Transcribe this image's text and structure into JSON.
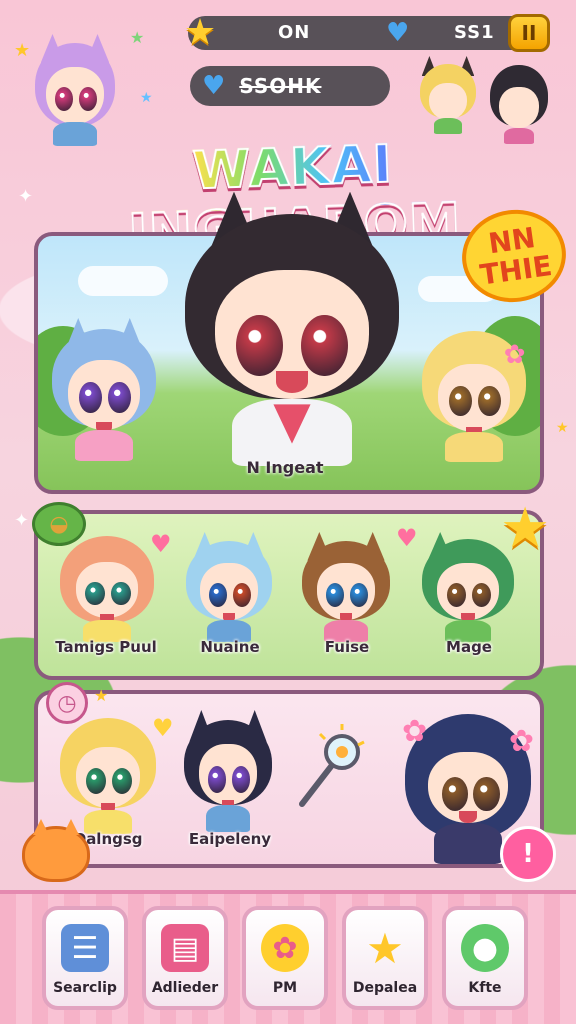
{
  "status_bar": {
    "mode_label": "ON",
    "score": "SS1",
    "pause_label": "II"
  },
  "search": {
    "text": "SSOHK"
  },
  "title": "WAKAI INGHAROM",
  "badge": {
    "line1": "NN",
    "line2": "THIE"
  },
  "hero": {
    "name": "N Ingeat"
  },
  "row_characters": [
    {
      "name": "Tamigs Puul"
    },
    {
      "name": "Nuaine"
    },
    {
      "name": "Fuise"
    },
    {
      "name": "Mage"
    }
  ],
  "bottom_characters": [
    {
      "name": "Qalngsg"
    },
    {
      "name": "Eaipeleny"
    }
  ],
  "bottom_nav": [
    {
      "label": "Searclip",
      "icon": "document-icon"
    },
    {
      "label": "Adlieder",
      "icon": "register-icon"
    },
    {
      "label": "PM",
      "icon": "flower-badge-icon"
    },
    {
      "label": "Depalea",
      "icon": "star-icon"
    },
    {
      "label": "Kfte",
      "icon": "leaf-bubble-icon"
    }
  ],
  "chat_label": "!",
  "colors": {
    "pink_bg": "#f7d4df",
    "panel_border": "#8a5a7d",
    "accent_pink": "#ff5fa0",
    "gold": "#ffcf2e"
  }
}
